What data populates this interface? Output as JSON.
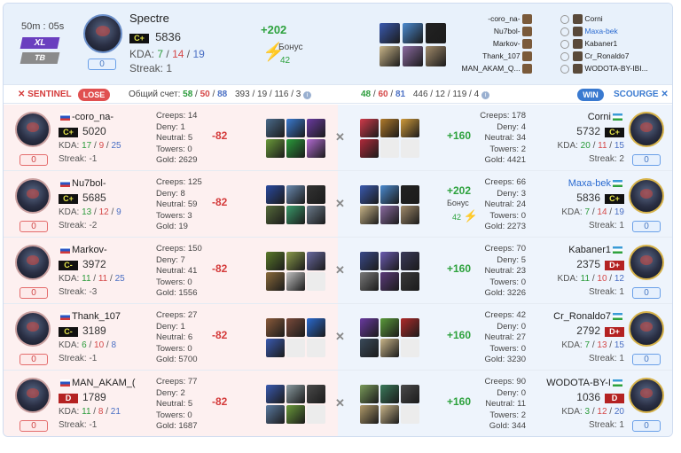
{
  "header": {
    "timer": "50m : 05s",
    "mode": "XL",
    "mode2": "TB",
    "hero_name": "Spectre",
    "rank": "C+",
    "rating": "5836",
    "kda_label": "KDA:",
    "kills": "7",
    "deaths": "14",
    "assists": "19",
    "streak": "Streak: 1",
    "votes": "0",
    "gold_delta": "+202",
    "bonus_label": "Бонус",
    "bonus_value": "42",
    "players": [
      {
        "left": "-coro_na-",
        "right": "Corni",
        "highlight": false
      },
      {
        "left": "Nu7bol-",
        "right": "Maxa-bek",
        "highlight": true
      },
      {
        "left": "Markov-",
        "right": "Kabaner1",
        "highlight": false
      },
      {
        "left": "Thank_107",
        "right": "Cr_Ronaldo7",
        "highlight": false
      },
      {
        "left": "MAN_AKAM_Q...",
        "right": "WODOTA-BY-IBI...",
        "highlight": false
      }
    ]
  },
  "teambar": {
    "sentinel": "SENTINEL",
    "lose": "LOSE",
    "total_label": "Общий счет:",
    "s_kills": "58",
    "s_deaths": "50",
    "s_assists": "88",
    "s_extra": "393 / 19 / 116 / 3",
    "sc_kills": "48",
    "sc_deaths": "60",
    "sc_assists": "81",
    "sc_extra": "446 / 12 / 119 / 4",
    "win": "WIN",
    "scourge": "SCOURGE"
  },
  "rows": [
    {
      "l": {
        "name": "-coro_na-",
        "rank": "C+",
        "rating": "5020",
        "k": "17",
        "d": "9",
        "a": "25",
        "streak": "Streak: -1",
        "votes": "0",
        "creeps": "Creeps: 14",
        "deny": "Deny: 1",
        "neutral": "Neutral: 5",
        "towers": "Towers: 0",
        "gold": "Gold: 2629",
        "delta": "-82"
      },
      "r": {
        "name": "Corni",
        "rank": "C+",
        "rating": "5732",
        "k": "20",
        "d": "11",
        "a": "15",
        "streak": "Streak: 2",
        "votes": "0",
        "creeps": "Creeps: 178",
        "deny": "Deny: 4",
        "neutral": "Neutral: 34",
        "towers": "Towers: 2",
        "gold": "Gold: 4421",
        "delta": "+160"
      }
    },
    {
      "l": {
        "name": "Nu7bol-",
        "rank": "C+",
        "rating": "5685",
        "k": "13",
        "d": "12",
        "a": "9",
        "streak": "Streak: -2",
        "votes": "0",
        "creeps": "Creeps: 125",
        "deny": "Deny: 8",
        "neutral": "Neutral: 59",
        "towers": "Towers: 3",
        "gold": "Gold: 19",
        "delta": "-82"
      },
      "r": {
        "name": "Maxa-bek",
        "rank": "C+",
        "rating": "5836",
        "k": "7",
        "d": "14",
        "a": "19",
        "streak": "Streak: 1",
        "votes": "0",
        "creeps": "Creeps: 66",
        "deny": "Deny: 3",
        "neutral": "Neutral: 24",
        "towers": "Towers: 0",
        "gold": "Gold: 2273",
        "delta": "+202",
        "bonus": "Бонус",
        "bonus_val": "42"
      }
    },
    {
      "l": {
        "name": "Markov-",
        "rank": "C-",
        "rating": "3972",
        "k": "11",
        "d": "11",
        "a": "25",
        "streak": "Streak: -3",
        "votes": "0",
        "creeps": "Creeps: 150",
        "deny": "Deny: 7",
        "neutral": "Neutral: 41",
        "towers": "Towers: 0",
        "gold": "Gold: 1556",
        "delta": "-82"
      },
      "r": {
        "name": "Kabaner1",
        "rank": "D+",
        "rating": "2375",
        "k": "11",
        "d": "10",
        "a": "12",
        "streak": "Streak: 1",
        "votes": "0",
        "creeps": "Creeps: 70",
        "deny": "Deny: 5",
        "neutral": "Neutral: 23",
        "towers": "Towers: 0",
        "gold": "Gold: 3226",
        "delta": "+160"
      }
    },
    {
      "l": {
        "name": "Thank_107",
        "rank": "C-",
        "rating": "3189",
        "k": "6",
        "d": "10",
        "a": "8",
        "streak": "Streak: -1",
        "votes": "0",
        "creeps": "Creeps: 27",
        "deny": "Deny: 1",
        "neutral": "Neutral: 6",
        "towers": "Towers: 0",
        "gold": "Gold: 5700",
        "delta": "-82"
      },
      "r": {
        "name": "Cr_Ronaldo7",
        "rank": "D+",
        "rating": "2792",
        "k": "7",
        "d": "13",
        "a": "15",
        "streak": "Streak: 1",
        "votes": "0",
        "creeps": "Creeps: 42",
        "deny": "Deny: 0",
        "neutral": "Neutral: 27",
        "towers": "Towers: 0",
        "gold": "Gold: 3230",
        "delta": "+160"
      }
    },
    {
      "l": {
        "name": "MAN_AKAM_(",
        "rank": "D",
        "rating": "1789",
        "k": "11",
        "d": "8",
        "a": "21",
        "streak": "Streak: -1",
        "votes": "0",
        "creeps": "Creeps: 77",
        "deny": "Deny: 2",
        "neutral": "Neutral: 5",
        "towers": "Towers: 0",
        "gold": "Gold: 1687",
        "delta": "-82"
      },
      "r": {
        "name": "WODOTA-BY-I",
        "rank": "D",
        "rating": "1036",
        "k": "3",
        "d": "12",
        "a": "20",
        "streak": "Streak: 1",
        "votes": "0",
        "creeps": "Creeps: 90",
        "deny": "Deny: 0",
        "neutral": "Neutral: 11",
        "towers": "Towers: 2",
        "gold": "Gold: 344",
        "delta": "+160"
      }
    }
  ],
  "item_colors": {
    "r0l": [
      "#4a6a8a",
      "#3a7ad0",
      "#6a3aa0",
      "#6a9a3a",
      "#2a9b3a",
      "#b06ad0"
    ],
    "r0r": [
      "#d03a4a",
      "#b07a2a",
      "#d09a3a",
      "#b02a3a",
      "#ececec",
      "#ececec"
    ],
    "r1l": [
      "#2a4aa0",
      "#6a8ab0",
      "#333333",
      "#556a3a",
      "#3a9a6a",
      "#6a7a8a"
    ],
    "r1r": [
      "#3a5ab0",
      "#4a8ad0",
      "#222222",
      "#c8b488",
      "#8a6aa0",
      "#a08a6a"
    ],
    "r2l": [
      "#5a7a2a",
      "#8a9a4a",
      "#6a6aa0",
      "#8a6a3a",
      "#c0c0c0",
      "#ececec"
    ],
    "r2r": [
      "#3a4a8a",
      "#6a5ab0",
      "#3a3a5a",
      "#7a7a7a",
      "#5a3a7a",
      "#3a3a3a"
    ],
    "r3l": [
      "#8a5a3a",
      "#7a4a3a",
      "#2a6ad0",
      "#3a5ab0",
      "#ececec",
      "#ececec"
    ],
    "r3r": [
      "#6a3aa0",
      "#5a9a3a",
      "#b02a2a",
      "#3a4a5a",
      "#c8b488",
      "#ececec"
    ],
    "r4l": [
      "#3a5ab0",
      "#8a9aa0",
      "#4a4a4a",
      "#5a7aa0",
      "#6a9a3a",
      "#ececec"
    ],
    "r4r": [
      "#7a9a5a",
      "#3a7a5a",
      "#4a4a4a",
      "#b09a6a",
      "#c8b488",
      "#ececec"
    ],
    "hdr": [
      "#3a5ab0",
      "#4a8ad0",
      "#222222",
      "#c8b488",
      "#8a6aa0",
      "#a08a6a"
    ]
  }
}
